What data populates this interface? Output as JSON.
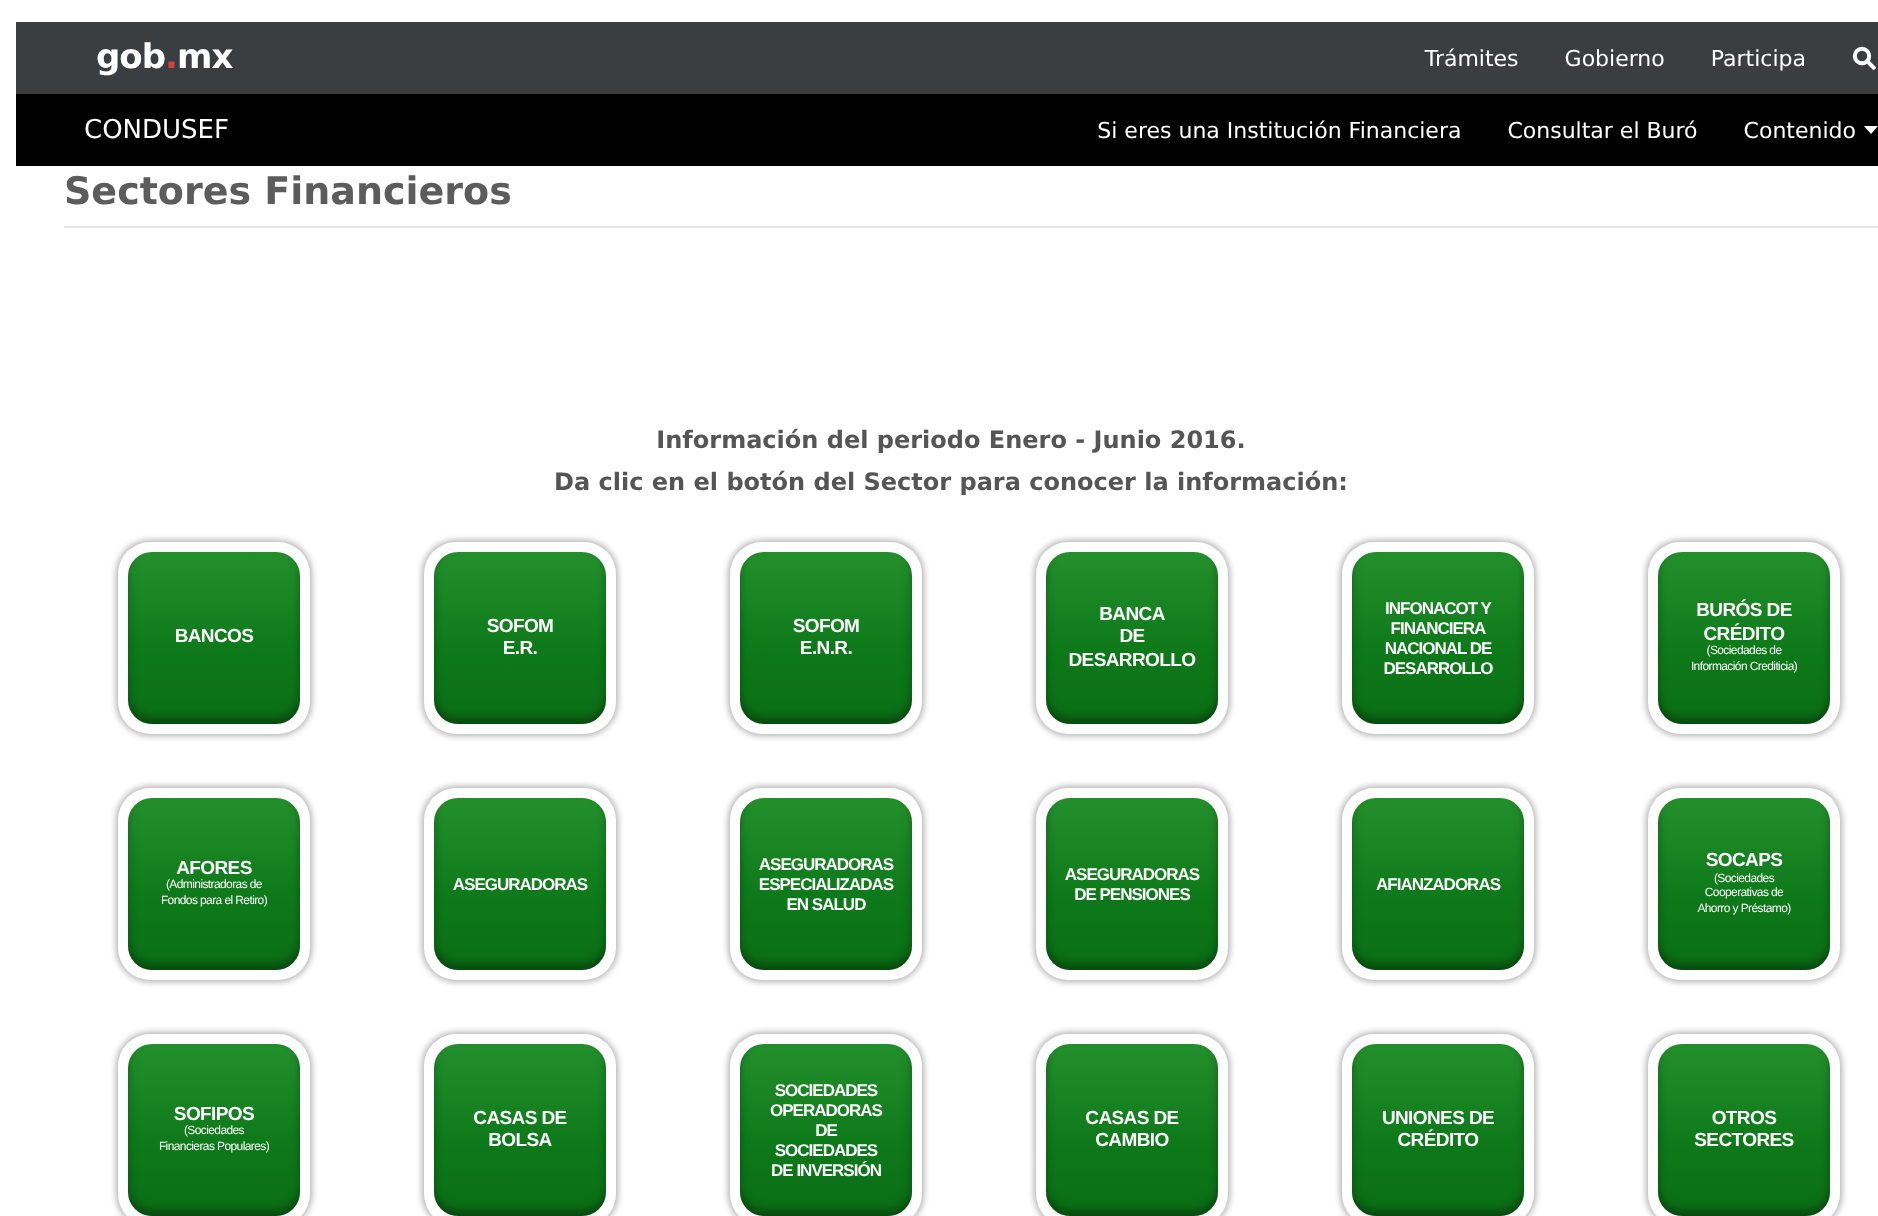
{
  "top_bar": {
    "logo": "gob.mx",
    "links": [
      "Trámites",
      "Gobierno",
      "Participa"
    ]
  },
  "sub_bar": {
    "brand": "CONDUSEF",
    "links": [
      {
        "label": "Si eres una Institución Financiera",
        "dropdown": false
      },
      {
        "label": "Consultar el Buró",
        "dropdown": false
      },
      {
        "label": "Contenido",
        "dropdown": true
      }
    ]
  },
  "page_title": "Sectores Financieros",
  "intro": [
    "Información del periodo Enero - Junio 2016.",
    "Da clic en el botón del Sector para conocer la información:"
  ],
  "sectors": [
    {
      "title": "BANCOS"
    },
    {
      "title": "SOFOM\nE.R."
    },
    {
      "title": "SOFOM\nE.N.R."
    },
    {
      "title": "BANCA\nDE\nDESARROLLO"
    },
    {
      "title": "INFONACOT Y\nFINANCIERA\nNACIONAL DE\nDESARROLLO"
    },
    {
      "title": "BURÓS DE\nCRÉDITO",
      "subtitle": "(Sociedades de\nInformación Crediticia)"
    },
    {
      "title": "AFORES",
      "subtitle": "(Administradoras de\nFondos para el Retiro)"
    },
    {
      "title": "ASEGURADORAS"
    },
    {
      "title": "ASEGURADORAS\nESPECIALIZADAS\nEN SALUD"
    },
    {
      "title": "ASEGURADORAS\nDE PENSIONES"
    },
    {
      "title": "AFIANZADORAS"
    },
    {
      "title": "SOCAPS",
      "subtitle": "(Sociedades\nCooperativas de\nAhorro y Préstamo)"
    },
    {
      "title": "SOFIPOS",
      "subtitle": "(Sociedades\nFinancieras Populares)"
    },
    {
      "title": "CASAS DE\nBOLSA"
    },
    {
      "title": "SOCIEDADES\nOPERADORAS\nDE\nSOCIEDADES\nDE INVERSIÓN"
    },
    {
      "title": "CASAS DE\nCAMBIO"
    },
    {
      "title": "UNIONES DE\nCRÉDITO"
    },
    {
      "title": "OTROS\nSECTORES"
    }
  ]
}
